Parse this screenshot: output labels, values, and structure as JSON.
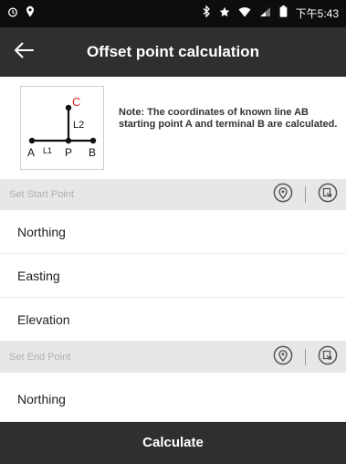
{
  "status_bar": {
    "time": "下午5:43",
    "left_icons": [
      "alarm-icon",
      "location-pin-icon"
    ],
    "right_icons": [
      "bluetooth-icon",
      "star-icon",
      "wifi-icon",
      "signal-icon",
      "battery-icon"
    ]
  },
  "header": {
    "title": "Offset point calculation",
    "back_icon": "arrow-left-icon"
  },
  "note": {
    "text": "Note: The coordinates of known line AB starting point A and terminal B are calculated.",
    "diagram_labels": {
      "a": "A",
      "l1": "L1",
      "p": "P",
      "b": "B",
      "l2": "L2",
      "c": "C"
    },
    "colors": {
      "line": "#111111",
      "point_c": "#e02020"
    }
  },
  "start_section": {
    "label": "Set Start Point",
    "fields": [
      "Northing",
      "Easting",
      "Elevation"
    ]
  },
  "end_section": {
    "label": "Set End Point",
    "fields": [
      "Northing"
    ]
  },
  "section_tools": [
    "location-pin-icon",
    "import-point-icon"
  ],
  "actions": {
    "calculate_label": "Calculate"
  },
  "theme": {
    "bar_color": "#2f2f2f",
    "status_color": "#0d0d0d",
    "section_bg": "#e7e7e7",
    "section_text": "#b0b0b0"
  }
}
